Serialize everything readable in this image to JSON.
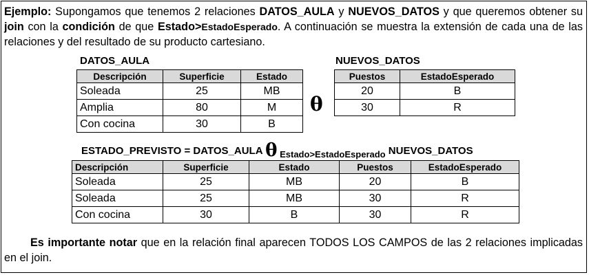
{
  "intro": {
    "p1": "Ejemplo:",
    "p2": " Supongamos que tenemos 2 relaciones ",
    "p3": "DATOS_AULA",
    "p4": " y ",
    "p5": "NUEVOS_DATOS",
    "p6": " y que queremos obtener su ",
    "p7": "join",
    "p8": " con la ",
    "p9": "condición",
    "p10": "  de que ",
    "p11": "Estado>",
    "p12": "EstadoEsperado",
    "p13": ". A continuación se  muestra la extensión de cada una de las relaciones y del resultado de su producto cartesiano."
  },
  "table_datos_aula": {
    "title": "DATOS_AULA",
    "headers": [
      "Descripción",
      "Superficie",
      "Estado"
    ],
    "rows": [
      [
        "Soleada",
        "25",
        "MB"
      ],
      [
        "Amplia",
        "80",
        "M"
      ],
      [
        "Con cocina",
        "30",
        "B"
      ]
    ]
  },
  "theta_symbol": "θ",
  "table_nuevos_datos": {
    "title": "NUEVOS_DATOS",
    "headers": [
      "Puestos",
      "EstadoEsperado"
    ],
    "rows": [
      [
        "20",
        "B"
      ],
      [
        "30",
        "R"
      ]
    ]
  },
  "formula": {
    "lhs": "ESTADO_PREVISTO = DATOS_AULA ",
    "theta": "θ",
    "condition": " Estado>EstadoEsperado",
    "rhs": " NUEVOS_DATOS"
  },
  "table_result": {
    "headers": [
      "Descripción",
      "Superficie",
      "Estado",
      "Puestos",
      "EstadoEsperado"
    ],
    "rows": [
      [
        "Soleada",
        "25",
        "MB",
        "20",
        "B"
      ],
      [
        "Soleada",
        "25",
        "MB",
        "30",
        "R"
      ],
      [
        "Con cocina",
        "30",
        "B",
        "30",
        "R"
      ]
    ]
  },
  "note": {
    "bold": "Es importante notar",
    "rest": " que en la relación final aparecen TODOS LOS CAMPOS de las 2 relaciones implicadas en el join."
  }
}
